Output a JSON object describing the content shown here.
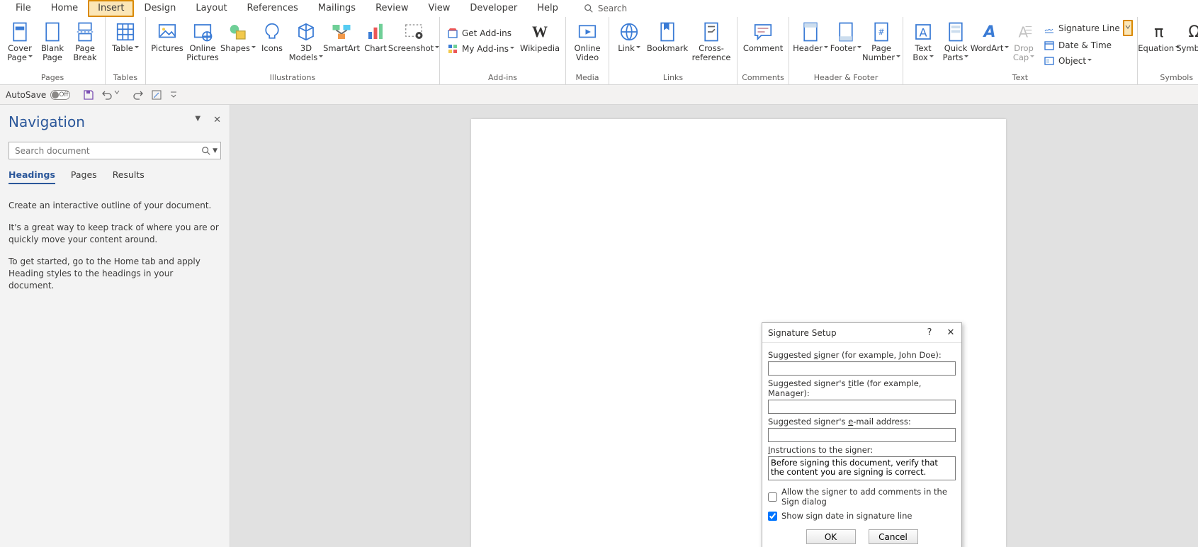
{
  "tabs": [
    "File",
    "Home",
    "Insert",
    "Design",
    "Layout",
    "References",
    "Mailings",
    "Review",
    "View",
    "Developer",
    "Help"
  ],
  "active_tab_index": 2,
  "search_placeholder": "Search",
  "ribbon": {
    "pages": {
      "label": "Pages",
      "cover": "Cover\nPage",
      "blank": "Blank\nPage",
      "break": "Page\nBreak"
    },
    "tables": {
      "label": "Tables",
      "table": "Table"
    },
    "illus": {
      "label": "Illustrations",
      "pictures": "Pictures",
      "online": "Online\nPictures",
      "shapes": "Shapes",
      "icons": "Icons",
      "models": "3D\nModels",
      "smartart": "SmartArt",
      "chart": "Chart",
      "screenshot": "Screenshot"
    },
    "addins": {
      "label": "Add-ins",
      "get": "Get Add-ins",
      "my": "My Add-ins",
      "wiki": "Wikipedia"
    },
    "media": {
      "label": "Media",
      "online": "Online\nVideo"
    },
    "links": {
      "label": "Links",
      "link": "Link",
      "bookmark": "Bookmark",
      "cross": "Cross-\nreference"
    },
    "comments": {
      "label": "Comments",
      "comment": "Comment"
    },
    "hf": {
      "label": "Header & Footer",
      "header": "Header",
      "footer": "Footer",
      "page": "Page\nNumber"
    },
    "text": {
      "label": "Text",
      "textbox": "Text\nBox",
      "quick": "Quick\nParts",
      "wordart": "WordArt",
      "drop": "Drop\nCap",
      "sig": "Signature Line",
      "date": "Date & Time",
      "obj": "Object"
    },
    "symbols": {
      "label": "Symbols",
      "eq": "Equation",
      "sym": "Symbol"
    }
  },
  "qat": {
    "autosave": "AutoSave",
    "off": "Off"
  },
  "nav": {
    "title": "Navigation",
    "search_placeholder": "Search document",
    "tabs": [
      "Headings",
      "Pages",
      "Results"
    ],
    "active": 0,
    "p1": "Create an interactive outline of your document.",
    "p2": "It's a great way to keep track of where you are or quickly move your content around.",
    "p3": "To get started, go to the Home tab and apply Heading styles to the headings in your document."
  },
  "dialog": {
    "title": "Signature Setup",
    "signer": "Suggested signer (for example, John Doe):",
    "stitle": "Suggested signer's title (for example, Manager):",
    "email": "Suggested signer's e-mail address:",
    "instr": "Instructions to the signer:",
    "instr_default": "Before signing this document, verify that the content you are signing is correct.",
    "allow": "Allow the signer to add comments in the Sign dialog",
    "showdate": "Show sign date in signature line",
    "ok": "OK",
    "cancel": "Cancel"
  }
}
